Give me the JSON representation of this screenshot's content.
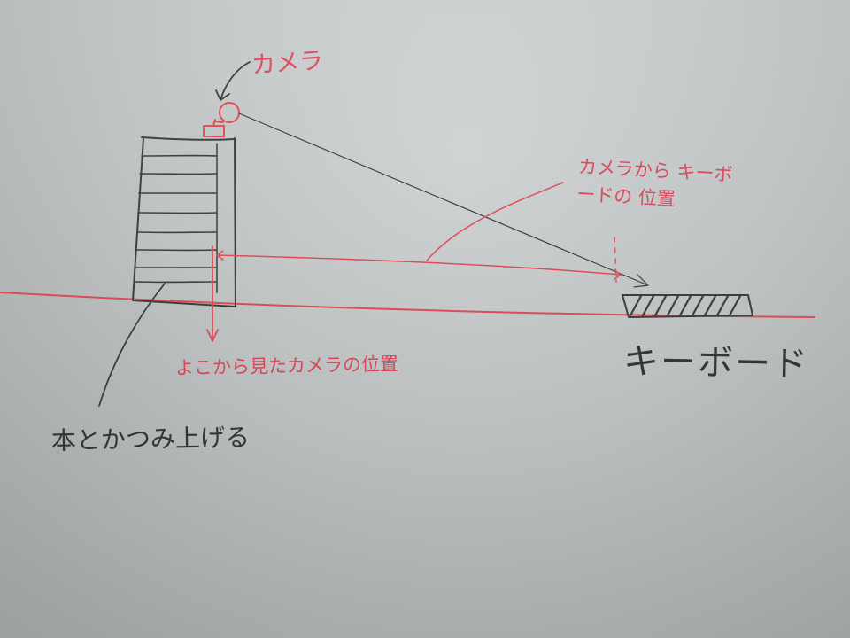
{
  "labels": {
    "camera": "カメラ",
    "camera_to_keyboard": "カメラから キーボードの 位置",
    "camera_from_side": "よこから見たカメラの位置",
    "keyboard": "キーボード",
    "stack_books": "本とかつみ上げる"
  }
}
